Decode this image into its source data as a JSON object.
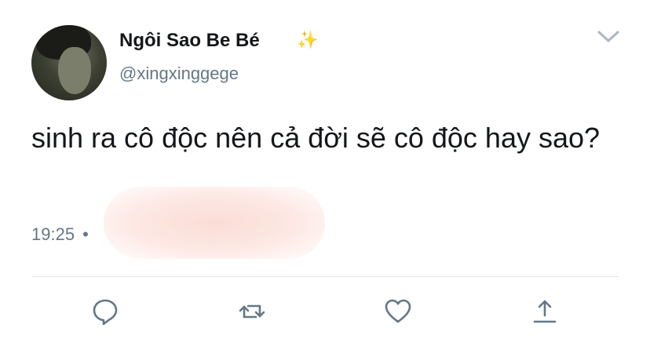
{
  "tweet": {
    "display_name": "Ngôi Sao Be Bé",
    "name_emoji": "✨",
    "handle": "@xingxinggege",
    "text": "sinh ra cô độc nên cả đời sẽ cô độc hay sao?",
    "time": "19:25",
    "separator": "•"
  },
  "actions": [
    {
      "name": "reply",
      "icon": "reply-icon"
    },
    {
      "name": "retweet",
      "icon": "retweet-icon"
    },
    {
      "name": "like",
      "icon": "heart-icon"
    },
    {
      "name": "share",
      "icon": "share-icon"
    }
  ],
  "colors": {
    "text": "#14171a",
    "secondary": "#657786",
    "divider": "#e1e8ed",
    "sparkle": "#f5c242"
  }
}
